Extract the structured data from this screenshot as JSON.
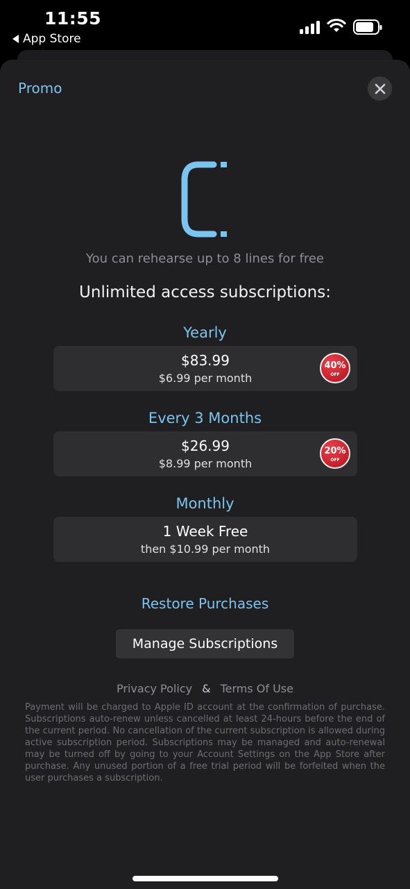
{
  "status_bar": {
    "time": "11:55",
    "back_label": "App Store"
  },
  "header": {
    "promo_label": "Promo",
    "close_icon": "close-icon"
  },
  "logo": {
    "icon": "app-logo-c",
    "accent_color": "#7bc4f0"
  },
  "tagline": "You can rehearse up to 8 lines for free",
  "headline": "Unlimited access subscriptions:",
  "plans": [
    {
      "name": "Yearly",
      "price": "$83.99",
      "sub": "$6.99 per month",
      "badge_pct": "40%",
      "badge_off": "OFF"
    },
    {
      "name": "Every 3 Months",
      "price": "$26.99",
      "sub": "$8.99 per month",
      "badge_pct": "20%",
      "badge_off": "OFF"
    },
    {
      "name": "Monthly",
      "price": "1 Week Free",
      "sub": "then $10.99 per month"
    }
  ],
  "restore_label": "Restore Purchases",
  "manage_label": "Manage Subscriptions",
  "legal": {
    "privacy_label": "Privacy Policy",
    "ampersand": "&",
    "terms_label": "Terms Of Use",
    "disclaimer": "Payment will be charged to Apple ID account at the confirmation of purchase. Subscriptions auto-renew unless cancelled at least 24-hours before the end of the current period. No cancellation of the current subscription is allowed during active subscription period. Subscriptions may be managed and auto-renewal may be turned off by going to your Account Settings on the App Store after purchase. Any unused portion of a free trial period will be forfeited when the user purchases a subscription."
  },
  "colors": {
    "accent": "#7bc4f0",
    "sheet_bg": "#1f1f21",
    "card_bg": "#2e2e30",
    "badge_red": "#c8141e"
  }
}
